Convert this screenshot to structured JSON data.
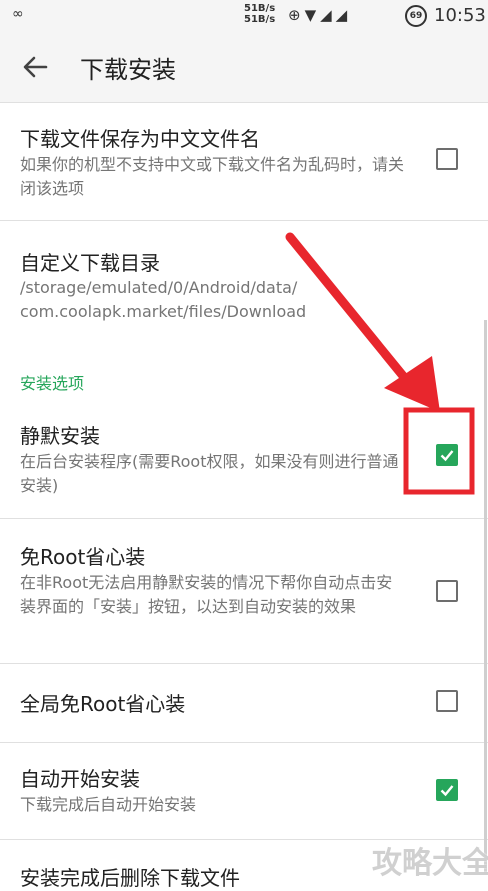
{
  "status_bar": {
    "speed_line1": "51B/s",
    "speed_line2": "51B/s",
    "battery": "69",
    "time": "10:53"
  },
  "toolbar": {
    "title": "下载安装"
  },
  "items": [
    {
      "title": "下载文件保存为中文文件名",
      "subtitle": "如果你的机型不支持中文或下载文件名为乱码时，请关闭该选项",
      "checked": false
    },
    {
      "title": "自定义下载目录",
      "subtitle_line1": "/storage/emulated/0/Android/data/",
      "subtitle_line2": "com.coolapk.market/files/Download"
    }
  ],
  "install_section": {
    "label": "安装选项",
    "items": [
      {
        "title": "静默安装",
        "subtitle": "在后台安装程序(需要Root权限，如果没有则进行普通安装)",
        "checked": true
      },
      {
        "title": "免Root省心装",
        "subtitle": "在非Root无法启用静默安装的情况下帮你自动点击安装界面的「安装」按钮，以达到自动安装的效果",
        "checked": false
      },
      {
        "title": "全局免Root省心装",
        "checked": false
      },
      {
        "title": "自动开始安装",
        "subtitle": "下载完成后自动开始安装",
        "checked": true
      },
      {
        "title": "安装完成后删除下载文件"
      }
    ]
  },
  "colors": {
    "accent": "#26a65b",
    "annotation_red": "#e8262d"
  },
  "watermark": "攻略大全"
}
